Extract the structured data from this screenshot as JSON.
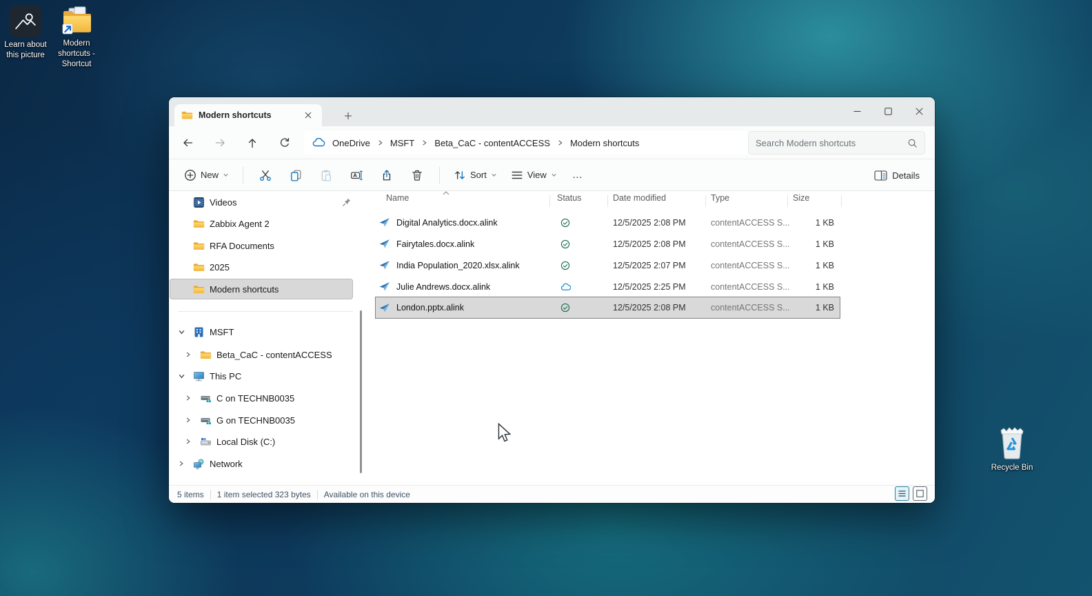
{
  "desktop": {
    "learn_about_label": "Learn about this picture",
    "shortcut_label": "Modern shortcuts - Shortcut",
    "recycle_bin_label": "Recycle Bin"
  },
  "window": {
    "tab_title": "Modern shortcuts",
    "breadcrumb": [
      "OneDrive",
      "MSFT",
      "Beta_CaC - contentACCESS",
      "Modern shortcuts"
    ],
    "search_placeholder": "Search Modern shortcuts",
    "toolbar": {
      "new_label": "New",
      "sort_label": "Sort",
      "view_label": "View",
      "more_glyph": "…",
      "details_label": "Details"
    },
    "sidebar": {
      "pinned": [
        {
          "label": "Videos",
          "pinned": true
        },
        {
          "label": "Zabbix Agent 2"
        },
        {
          "label": "RFA Documents"
        },
        {
          "label": "2025"
        },
        {
          "label": "Modern shortcuts",
          "selected": true
        }
      ],
      "tree": [
        {
          "label": "MSFT",
          "expanded": true
        },
        {
          "label": "Beta_CaC - contentACCESS"
        },
        {
          "label": "This PC",
          "expanded": true
        },
        {
          "label": "C on TECHNB0035"
        },
        {
          "label": "G on TECHNB0035"
        },
        {
          "label": "Local Disk (C:)"
        },
        {
          "label": "Network"
        }
      ]
    },
    "columns": {
      "name": "Name",
      "status": "Status",
      "modified": "Date modified",
      "type": "Type",
      "size": "Size"
    },
    "files": [
      {
        "name": "Digital Analytics.docx.alink",
        "status": "synced",
        "modified": "12/5/2025 2:08 PM",
        "type": "contentACCESS S...",
        "size": "1 KB"
      },
      {
        "name": "Fairytales.docx.alink",
        "status": "synced",
        "modified": "12/5/2025 2:08 PM",
        "type": "contentACCESS S...",
        "size": "1 KB"
      },
      {
        "name": "India Population_2020.xlsx.alink",
        "status": "synced",
        "modified": "12/5/2025 2:07 PM",
        "type": "contentACCESS S...",
        "size": "1 KB"
      },
      {
        "name": "Julie Andrews.docx.alink",
        "status": "cloud-only",
        "modified": "12/5/2025 2:25 PM",
        "type": "contentACCESS S...",
        "size": "1 KB"
      },
      {
        "name": "London.pptx.alink",
        "status": "synced",
        "selected": true,
        "modified": "12/5/2025 2:08 PM",
        "type": "contentACCESS S...",
        "size": "1 KB"
      }
    ],
    "statusbar": {
      "items": "5 items",
      "selection": "1 item selected  323 bytes",
      "availability": "Available on this device"
    },
    "colors": {
      "accent_blue": "#1273b8",
      "sync_check_green": "#1d7050",
      "cloud_blue": "#0f8bd6",
      "folder_yellow": "#f3bb45",
      "selection_gray": "#d9d9d9"
    }
  }
}
